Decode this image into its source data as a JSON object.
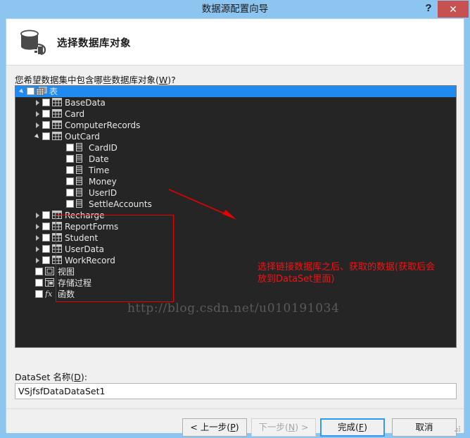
{
  "window": {
    "title": "数据源配置向导",
    "help_label": "?",
    "close_label": "✕"
  },
  "banner": {
    "title": "选择数据库对象",
    "icon": "database-cylinder-icon"
  },
  "prompt": {
    "text_before": "您希望数据集中包含哪些数据库对象(",
    "accelerator": "W",
    "text_after": ")?"
  },
  "tree": {
    "root": {
      "label": "表",
      "icon": "tables-stack-icon",
      "checked": false,
      "selected": true,
      "expanded": true
    },
    "tables": [
      {
        "label": "BaseData",
        "icon": "table-icon",
        "checked": false,
        "expanded": false,
        "columns": []
      },
      {
        "label": "Card",
        "icon": "table-icon",
        "checked": false,
        "expanded": false,
        "columns": []
      },
      {
        "label": "ComputerRecords",
        "icon": "table-icon",
        "checked": false,
        "expanded": false,
        "columns": []
      },
      {
        "label": "OutCard",
        "icon": "table-icon",
        "checked": false,
        "expanded": true,
        "columns": [
          {
            "label": "CardID",
            "icon": "column-icon",
            "checked": false
          },
          {
            "label": "Date",
            "icon": "column-icon",
            "checked": false
          },
          {
            "label": "Time",
            "icon": "column-icon",
            "checked": false
          },
          {
            "label": "Money",
            "icon": "column-icon",
            "checked": false
          },
          {
            "label": "UserID",
            "icon": "column-icon",
            "checked": false
          },
          {
            "label": "SettleAccounts",
            "icon": "column-icon",
            "checked": false
          }
        ]
      },
      {
        "label": "Recharge",
        "icon": "table-icon",
        "checked": false,
        "expanded": false,
        "columns": []
      },
      {
        "label": "ReportForms",
        "icon": "table-icon",
        "checked": false,
        "expanded": false,
        "columns": []
      },
      {
        "label": "Student",
        "icon": "table-icon",
        "checked": false,
        "expanded": false,
        "columns": []
      },
      {
        "label": "UserData",
        "icon": "table-icon",
        "checked": false,
        "expanded": false,
        "columns": []
      },
      {
        "label": "WorkRecord",
        "icon": "table-icon",
        "checked": false,
        "expanded": false,
        "columns": []
      }
    ],
    "other_nodes": [
      {
        "label": "视图",
        "icon": "view-icon",
        "checked": false
      },
      {
        "label": "存储过程",
        "icon": "stored-procedure-icon",
        "checked": false
      },
      {
        "label": "函数",
        "icon": "function-fx-icon",
        "checked": false
      }
    ]
  },
  "annotation": {
    "text": "选择链接数据库之后、获取的数据(获取后会\n放到DataSet里面)",
    "color": "#f41212",
    "rect_color": "#e60000"
  },
  "watermark": {
    "text": "http://blog.csdn.net/u010191034"
  },
  "dataset": {
    "label_before": "DataSet 名称(",
    "label_accelerator": "D",
    "label_after": "):",
    "value": "VSjfsfDataDataSet1"
  },
  "buttons": {
    "previous": {
      "before": "< 上一步(",
      "acc": "P",
      "after": ")",
      "disabled": false
    },
    "next": {
      "before": "下一步(",
      "acc": "N",
      "after": ") >",
      "disabled": true
    },
    "finish": {
      "before": "完成(",
      "acc": "F",
      "after": ")",
      "disabled": false,
      "default": true
    },
    "cancel": {
      "before": "取消",
      "acc": "",
      "after": "",
      "disabled": false
    }
  },
  "colors": {
    "titlebar": "#8cc6f0",
    "close_button": "#c75050",
    "tree_background": "#252526",
    "selection": "#1f8bf0",
    "accent": "#3399ef"
  }
}
